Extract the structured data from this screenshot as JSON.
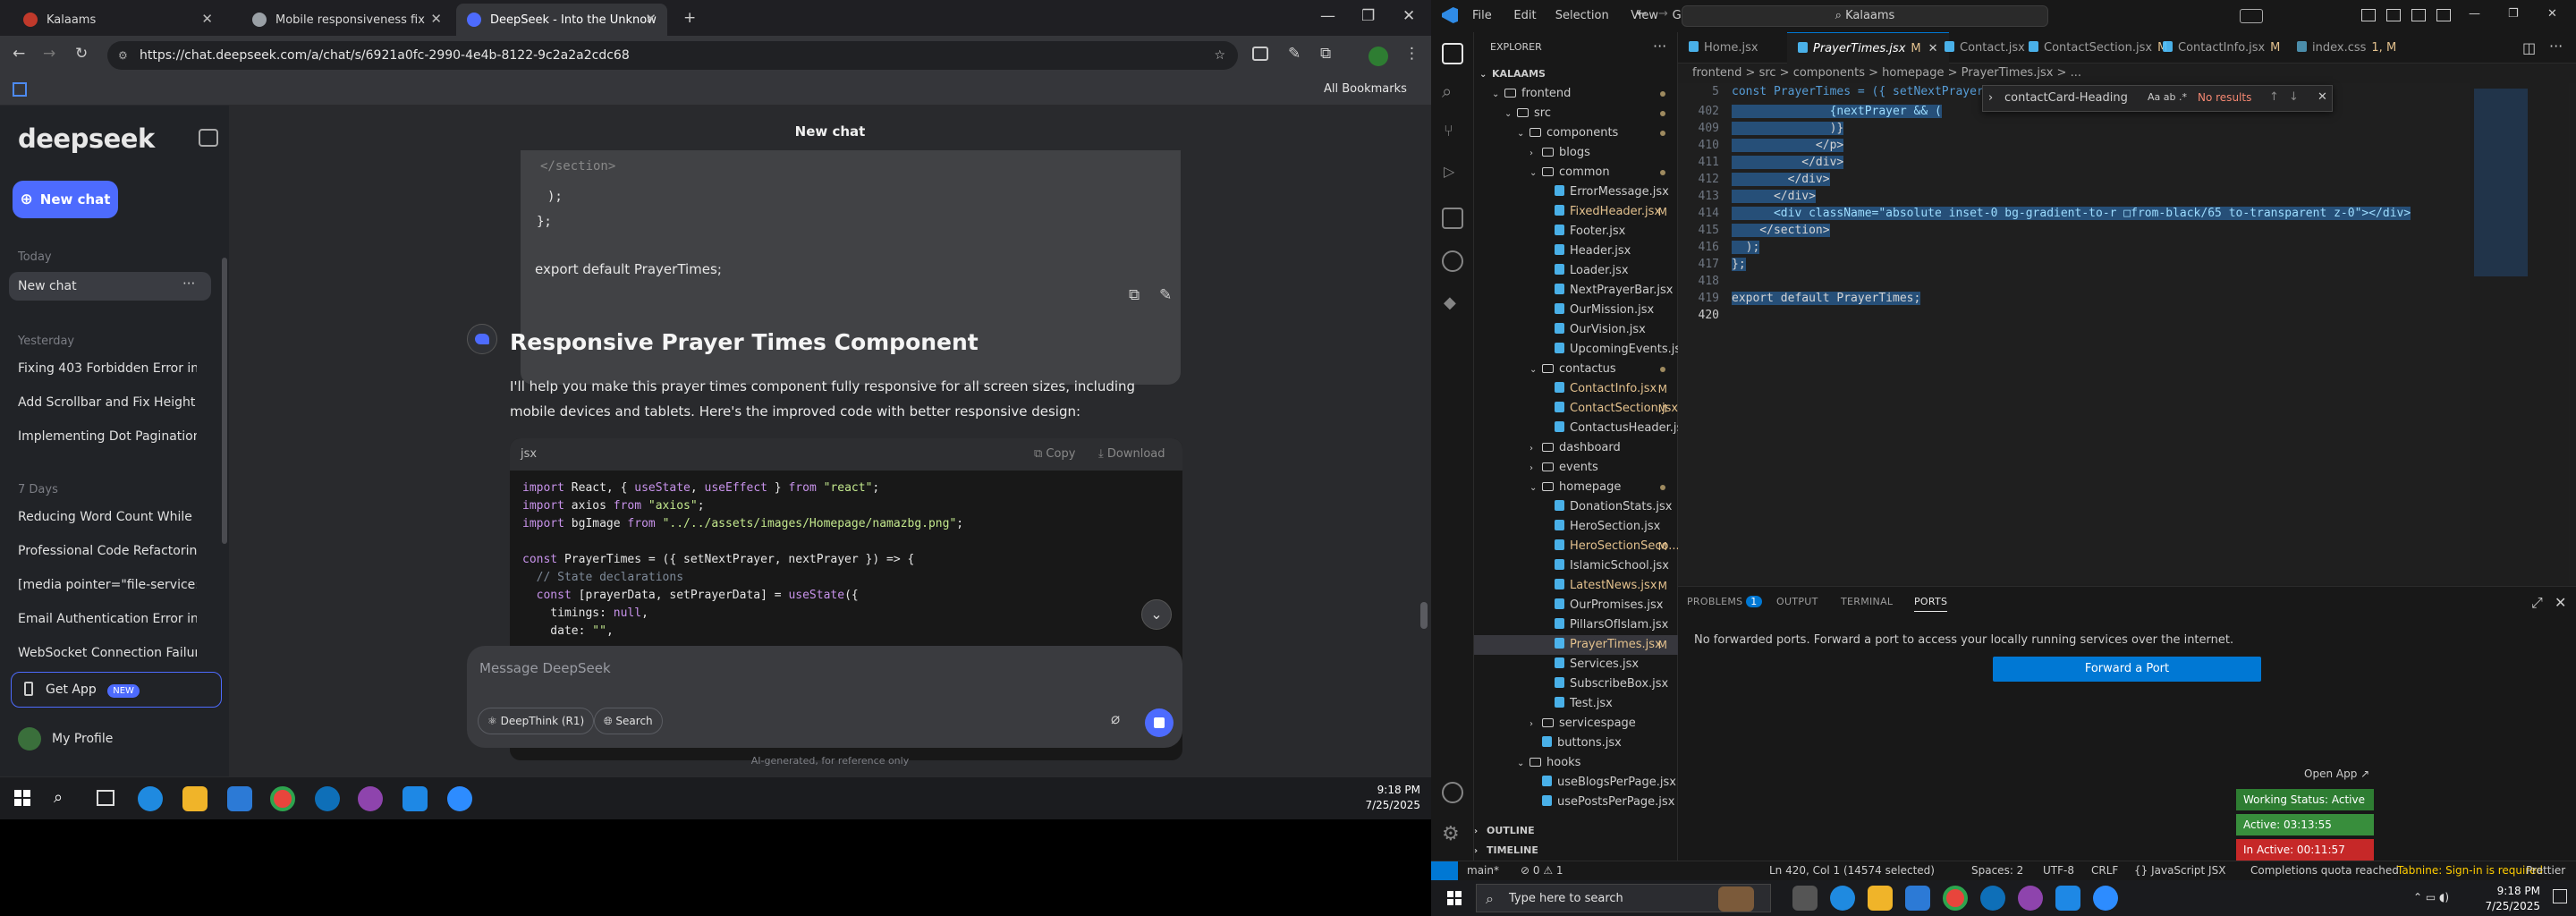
{
  "chrome": {
    "tabs": [
      {
        "title": "Kalaams",
        "color": "#c0392b"
      },
      {
        "title": "Mobile responsiveness fix",
        "color": "#9aa0a6"
      },
      {
        "title": "DeepSeek - Into the Unknown",
        "color": "#4d6bfe"
      }
    ],
    "url": "https://chat.deepseek.com/a/chat/s/6921a0fc-2990-4e4b-8122-9c2a2a2cdc68",
    "bookmarks_label": "All Bookmarks"
  },
  "deepseek": {
    "logo": "deepseek",
    "new_chat": "New chat",
    "today_label": "Today",
    "active_chat": "New chat",
    "yesterday_label": "Yesterday",
    "yesterday_items": [
      "Fixing 403 Forbidden Error in AP",
      "Add Scrollbar and Fix Height for",
      "Implementing Dot Pagination fo"
    ],
    "week_label": "7 Days",
    "week_items": [
      "Reducing Word Count While Pre",
      "Professional Code Refactoring a",
      "[media pointer=\"file-service://f",
      "Email Authentication Error in No",
      "WebSocket Connection Failure Tr"
    ],
    "get_app": "Get App",
    "new_badge": "NEW",
    "profile": "My Profile",
    "title": "New chat",
    "prev_code": [
      "</section>",
      ");",
      "};",
      "export default PrayerTimes;"
    ],
    "heading": "Responsive Prayer Times Component",
    "paragraph": "I'll help you make this prayer times component fully responsive for all screen sizes, including mobile devices and tablets. Here's the improved code with better responsive design:",
    "code_lang": "jsx",
    "copy": "Copy",
    "download": "Download",
    "code_lines": [
      "import React, { useState, useEffect } from \"react\";",
      "import axios from \"axios\";",
      "import bgImage from \"../../assets/images/Homepage/namazbg.png\";",
      "",
      "const PrayerTimes = ({ setNextPrayer, nextPrayer }) => {",
      "  // State declarations",
      "  const [prayerData, setPrayerData] = useState({",
      "    timings: null,",
      "    date: \"\","
    ],
    "placeholder": "Message DeepSeek",
    "deepthink": "DeepThink (R1)",
    "search": "Search",
    "footnote": "AI-generated, for reference only"
  },
  "taskbar_left": {
    "time": "9:18 PM",
    "date": "7/25/2025"
  },
  "vscode": {
    "menus": [
      "File",
      "Edit",
      "Selection",
      "View",
      "Go",
      "Run",
      "···"
    ],
    "search": "Kalaams",
    "explorer_title": "EXPLORER",
    "tree": [
      {
        "label": "KALAAMS",
        "depth": 0,
        "type": "root"
      },
      {
        "label": "frontend",
        "depth": 1,
        "type": "folder-open",
        "dot": true
      },
      {
        "label": "src",
        "depth": 2,
        "type": "folder-open",
        "dot": true
      },
      {
        "label": "components",
        "depth": 3,
        "type": "folder-open",
        "dot": true
      },
      {
        "label": "blogs",
        "depth": 4,
        "type": "folder"
      },
      {
        "label": "common",
        "depth": 4,
        "type": "folder-open",
        "dot": true
      },
      {
        "label": "ErrorMessage.jsx",
        "depth": 5,
        "type": "file"
      },
      {
        "label": "FixedHeader.jsx",
        "depth": 5,
        "type": "file",
        "m": "M"
      },
      {
        "label": "Footer.jsx",
        "depth": 5,
        "type": "file"
      },
      {
        "label": "Header.jsx",
        "depth": 5,
        "type": "file"
      },
      {
        "label": "Loader.jsx",
        "depth": 5,
        "type": "file"
      },
      {
        "label": "NextPrayerBar.jsx",
        "depth": 5,
        "type": "file"
      },
      {
        "label": "OurMission.jsx",
        "depth": 5,
        "type": "file"
      },
      {
        "label": "OurVision.jsx",
        "depth": 5,
        "type": "file"
      },
      {
        "label": "UpcomingEvents.jsx",
        "depth": 5,
        "type": "file"
      },
      {
        "label": "contactus",
        "depth": 4,
        "type": "folder-open",
        "dot": true
      },
      {
        "label": "ContactInfo.jsx",
        "depth": 5,
        "type": "file",
        "m": "M"
      },
      {
        "label": "ContactSection.jsx",
        "depth": 5,
        "type": "file",
        "m": "M"
      },
      {
        "label": "ContactusHeader.jsx",
        "depth": 5,
        "type": "file"
      },
      {
        "label": "dashboard",
        "depth": 4,
        "type": "folder"
      },
      {
        "label": "events",
        "depth": 4,
        "type": "folder"
      },
      {
        "label": "homepage",
        "depth": 4,
        "type": "folder-open",
        "dot": true
      },
      {
        "label": "DonationStats.jsx",
        "depth": 5,
        "type": "file"
      },
      {
        "label": "HeroSection.jsx",
        "depth": 5,
        "type": "file"
      },
      {
        "label": "HeroSectionSeco...",
        "depth": 5,
        "type": "file",
        "m": "M"
      },
      {
        "label": "IslamicSchool.jsx",
        "depth": 5,
        "type": "file"
      },
      {
        "label": "LatestNews.jsx",
        "depth": 5,
        "type": "file",
        "m": "M"
      },
      {
        "label": "OurPromises.jsx",
        "depth": 5,
        "type": "file"
      },
      {
        "label": "PillarsOfIslam.jsx",
        "depth": 5,
        "type": "file"
      },
      {
        "label": "PrayerTimes.jsx",
        "depth": 5,
        "type": "file",
        "m": "M",
        "selected": true
      },
      {
        "label": "Services.jsx",
        "depth": 5,
        "type": "file"
      },
      {
        "label": "SubscribeBox.jsx",
        "depth": 5,
        "type": "file"
      },
      {
        "label": "Test.jsx",
        "depth": 5,
        "type": "file"
      },
      {
        "label": "servicespage",
        "depth": 4,
        "type": "folder"
      },
      {
        "label": "buttons.jsx",
        "depth": 4,
        "type": "file"
      },
      {
        "label": "hooks",
        "depth": 3,
        "type": "folder-open"
      },
      {
        "label": "useBlogsPerPage.jsx",
        "depth": 4,
        "type": "file"
      },
      {
        "label": "usePostsPerPage.jsx",
        "depth": 4,
        "type": "file"
      }
    ],
    "outline": "OUTLINE",
    "timeline": "TIMELINE",
    "tabs": [
      {
        "label": "Home.jsx",
        "m": ""
      },
      {
        "label": "PrayerTimes.jsx",
        "m": "M",
        "active": true
      },
      {
        "label": "Contact.jsx",
        "m": ""
      },
      {
        "label": "ContactSection.jsx",
        "m": "M"
      },
      {
        "label": "ContactInfo.jsx",
        "m": "M"
      },
      {
        "label": "index.css",
        "m": "1, M"
      }
    ],
    "breadcrumb": "frontend > src > components > homepage > PrayerTimes.jsx > ...",
    "sticky_line": {
      "num": "5",
      "code": "const PrayerTimes = ({ setNextPrayer, nextPrayer"
    },
    "lines": [
      {
        "num": "402",
        "code": "              {nextPrayer && ("
      },
      {
        "num": "409",
        "code": "              )}"
      },
      {
        "num": "410",
        "code": "            </p>"
      },
      {
        "num": "411",
        "code": "          </div>"
      },
      {
        "num": "412",
        "code": "        </div>"
      },
      {
        "num": "413",
        "code": "      </div>"
      },
      {
        "num": "414",
        "code": "      <div className=\"absolute inset-0 bg-gradient-to-r □from-black/65 to-transparent z-0\"></div>"
      },
      {
        "num": "415",
        "code": "    </section>"
      },
      {
        "num": "416",
        "code": "  );"
      },
      {
        "num": "417",
        "code": "};"
      },
      {
        "num": "418",
        "code": ""
      },
      {
        "num": "419",
        "code": "export default PrayerTimes;"
      },
      {
        "num": "420",
        "code": ""
      }
    ],
    "find_value": "contactCard-Heading",
    "find_result": "No results",
    "panel_tabs": [
      "PROBLEMS",
      "OUTPUT",
      "TERMINAL",
      "PORTS"
    ],
    "problems_count": "1",
    "ports_msg": "No forwarded ports. Forward a port to access your locally running services over the internet.",
    "forward_btn": "Forward a Port",
    "open_app": "Open App ↗",
    "working_status": "Working Status: Active",
    "active_time": "Active: 03:13:55",
    "inactive_time": "In Active: 00:11:57",
    "status_left": [
      "main*",
      "⊘ 0 ⚠ 1"
    ],
    "status_right": [
      "Ln 420, Col 1 (14574 selected)",
      "Spaces: 2",
      "UTF-8",
      "CRLF",
      "{} JavaScript JSX",
      "Completions quota reached",
      "Tabnine: Sign-in is required",
      "Prettier"
    ]
  },
  "taskbar_right": {
    "search": "Type here to search",
    "time": "9:18 PM",
    "date": "7/25/2025"
  }
}
